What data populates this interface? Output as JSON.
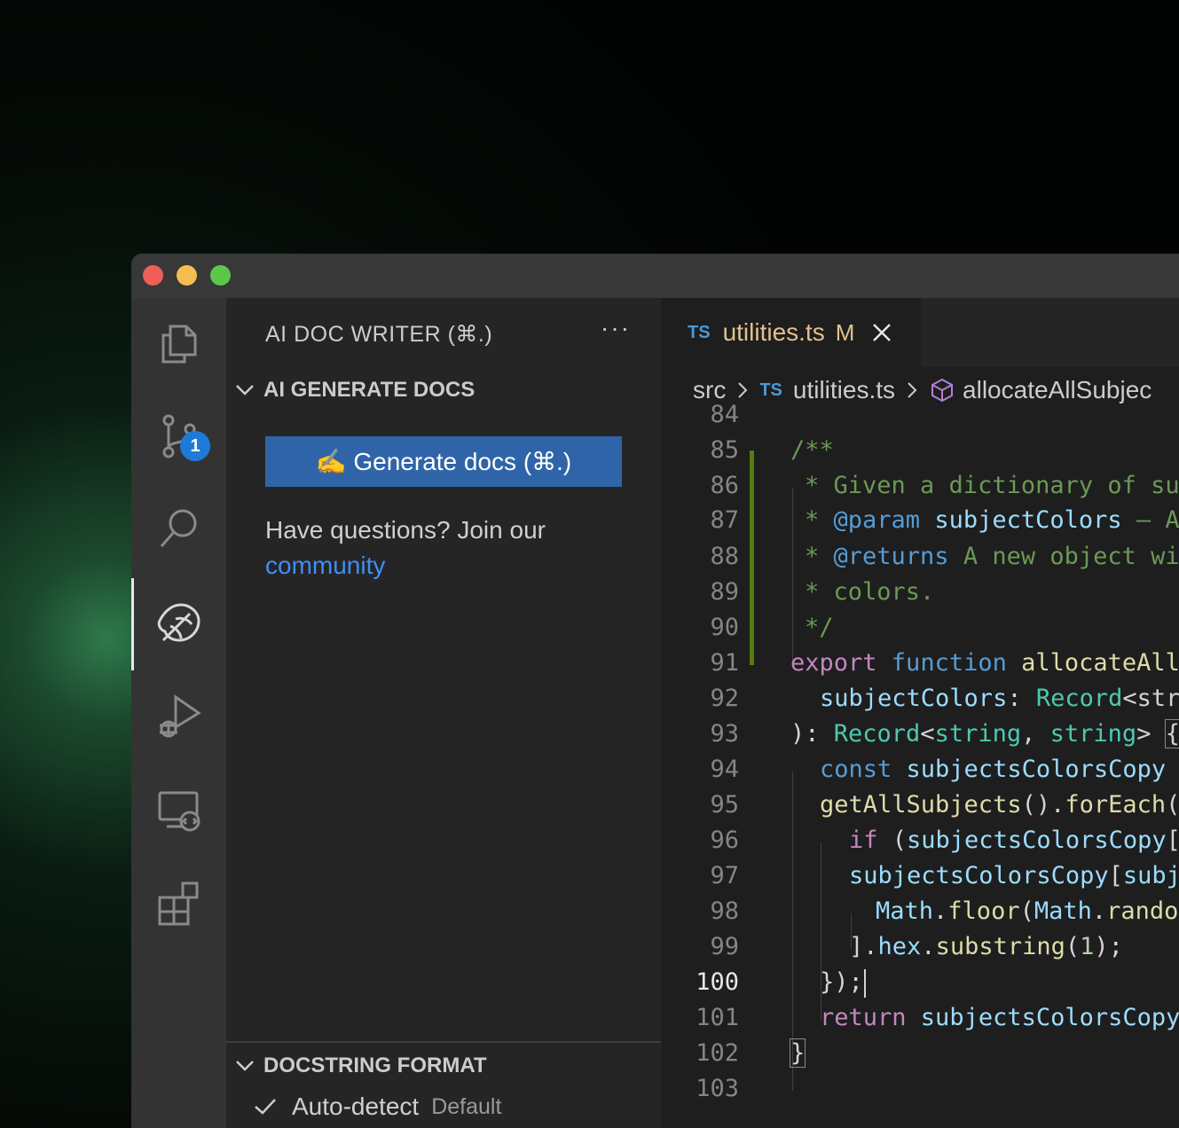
{
  "window": {
    "traffic_lights": {
      "close_color": "#ee5f57",
      "minimize_color": "#f5bd4f",
      "zoom_color": "#5cc74a"
    }
  },
  "activity_bar": {
    "items": [
      {
        "icon": "files-icon"
      },
      {
        "icon": "source-control-icon",
        "badge": "1"
      },
      {
        "icon": "search-icon"
      },
      {
        "icon": "ai-doc-writer-icon",
        "active": true
      },
      {
        "icon": "run-debug-icon"
      },
      {
        "icon": "remote-explorer-icon"
      },
      {
        "icon": "extensions-icon"
      }
    ]
  },
  "sidebar": {
    "title": "AI DOC WRITER (⌘.)",
    "more_actions": "···",
    "generate_section": {
      "heading": "AI GENERATE DOCS",
      "button_label": "✍️ Generate docs (⌘.)",
      "help_text": "Have questions? Join our",
      "help_link": "community"
    },
    "docstring_section": {
      "heading": "DOCSTRING FORMAT",
      "selected_option": "Auto-detect",
      "selected_option_note": "Default"
    }
  },
  "editor": {
    "tab": {
      "lang_badge": "TS",
      "file_name": "utilities.ts",
      "status": "M"
    },
    "breadcrumb": {
      "folder": "src",
      "lang_badge": "TS",
      "file": "utilities.ts",
      "symbol": "allocateAllSubjec"
    },
    "active_line": "100",
    "lines": [
      {
        "n": "84"
      },
      {
        "n": "85"
      },
      {
        "n": "86"
      },
      {
        "n": "87"
      },
      {
        "n": "88"
      },
      {
        "n": "89"
      },
      {
        "n": "90"
      },
      {
        "n": "91"
      },
      {
        "n": "92"
      },
      {
        "n": "93"
      },
      {
        "n": "94"
      },
      {
        "n": "95"
      },
      {
        "n": "96"
      },
      {
        "n": "97"
      },
      {
        "n": "98"
      },
      {
        "n": "99"
      },
      {
        "n": "100"
      },
      {
        "n": "101"
      },
      {
        "n": "102"
      },
      {
        "n": "103"
      }
    ],
    "tokens": {
      "l85": "/**",
      "l86": "* Given a dictionary of su",
      "l87_star": "* ",
      "l87_tag": "@param",
      "l87_var": " subjectColors",
      "l87_rest": " – A",
      "l88_star": "* ",
      "l88_tag": "@returns",
      "l88_rest": " A new object wi",
      "l89": "* colors.",
      "l90": "*/",
      "l91_kw": "export",
      "l91_st": " function",
      "l91_fn": " allocateAll",
      "l92_var": "subjectColors",
      "l92_pl": ": ",
      "l92_ty": "Record",
      "l92_rest": "<str",
      "l93_a": "): ",
      "l93_ty": "Record",
      "l93_b": "<",
      "l93_c": "string",
      "l93_d": ", ",
      "l93_e": "string",
      "l93_f": "> ",
      "l93_brace": "{",
      "l94_st": "const",
      "l94_var": " subjectsColorsCopy",
      "l95_fn": "getAllSubjects",
      "l95_a": "().",
      "l95_fn2": "forEach",
      "l95_b": "(",
      "l96_kw": "if",
      "l96_a": " (",
      "l96_var": "subjectsColorsCopy",
      "l96_b": "[",
      "l97_var": "subjectsColorsCopy",
      "l97_a": "[",
      "l97_var2": "subj",
      "l98_var": "Math",
      "l98_a": ".",
      "l98_fn": "floor",
      "l98_b": "(",
      "l98_var2": "Math",
      "l98_c": ".",
      "l98_fn2": "rando",
      "l99_a": "].",
      "l99_var": "hex",
      "l99_b": ".",
      "l99_fn": "substring",
      "l99_c": "(",
      "l99_num": "1",
      "l99_d": ");",
      "l100": "});",
      "l101_kw": "return",
      "l101_var": " subjectsColorsCopy",
      "l102": "}"
    }
  }
}
